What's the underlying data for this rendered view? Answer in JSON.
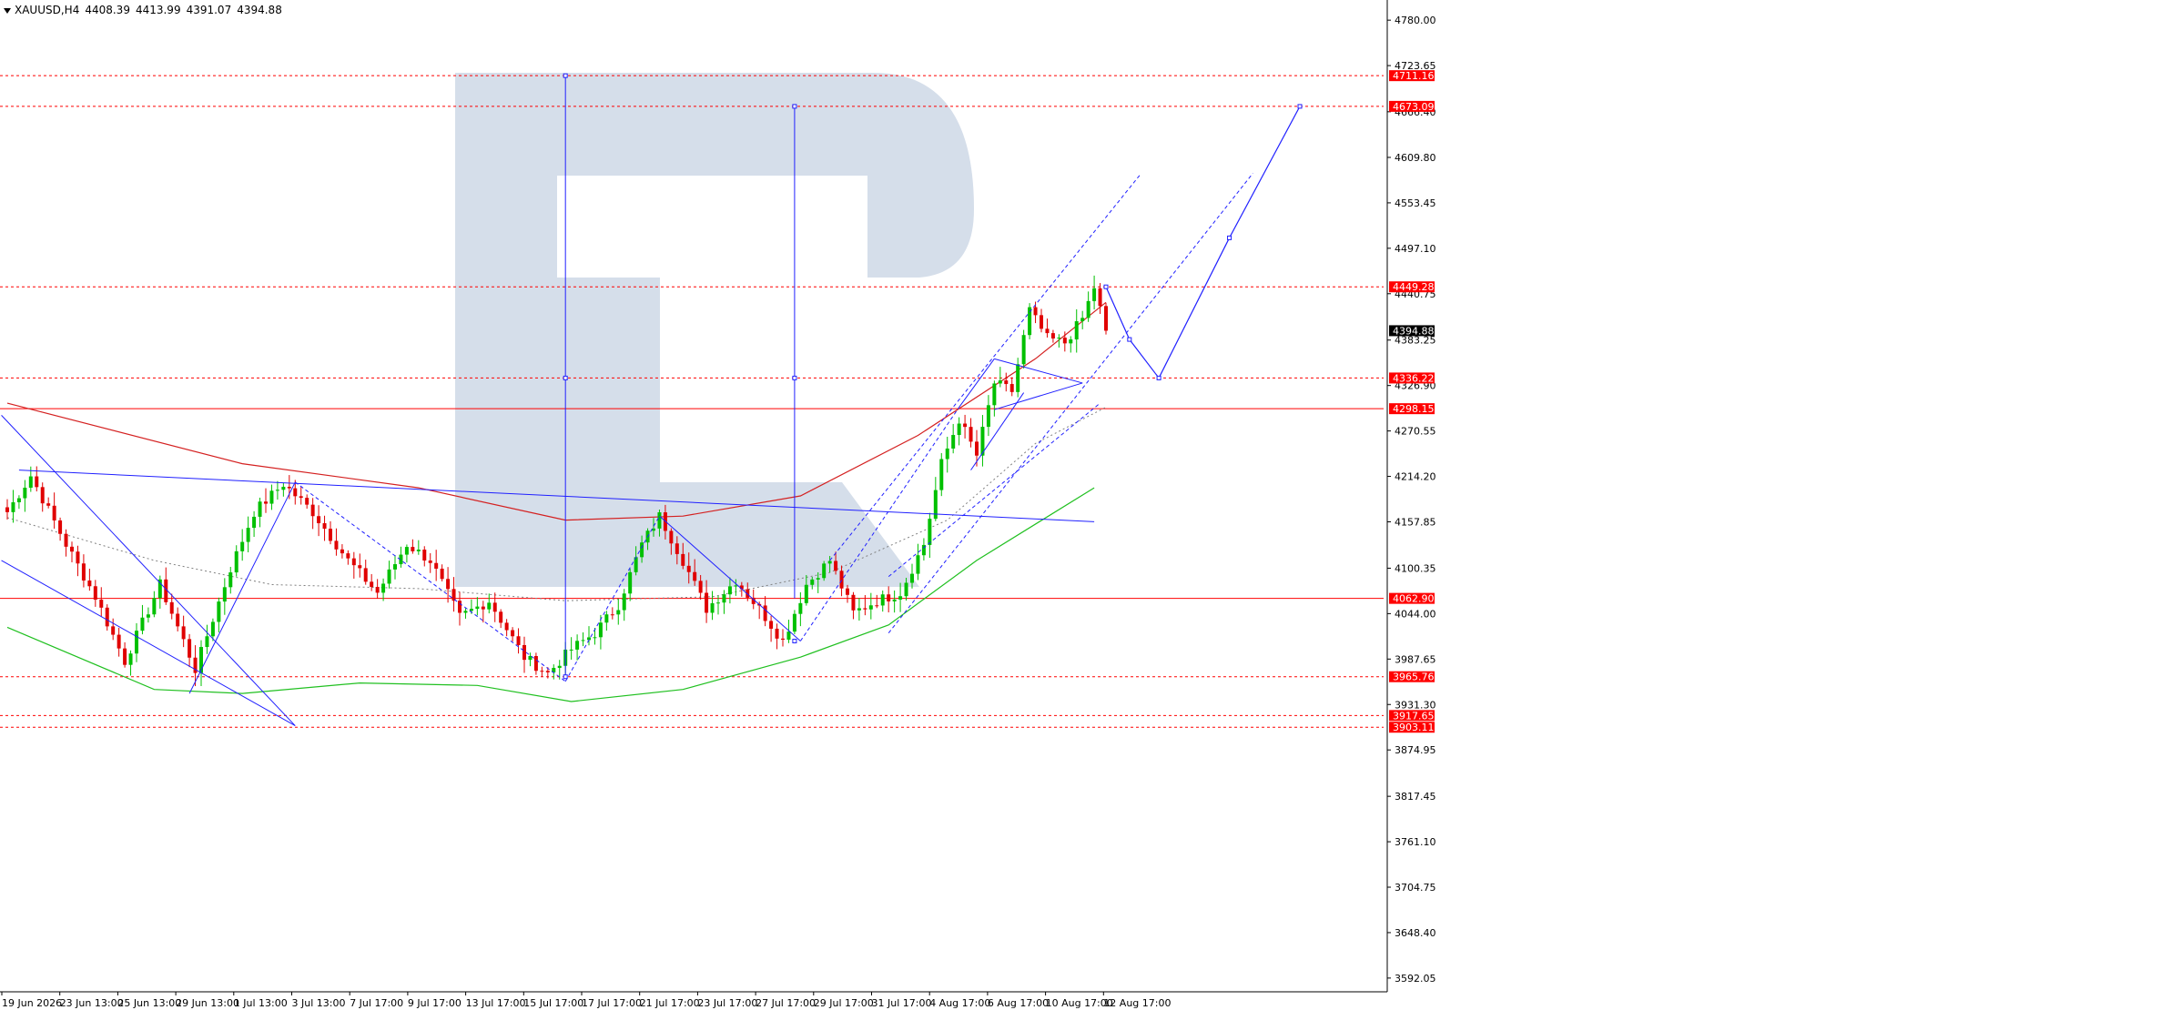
{
  "header": {
    "symbol": "XAUUSD,H4",
    "open": "4408.39",
    "high": "4413.99",
    "low": "4391.07",
    "close": "4394.88"
  },
  "colors": {
    "bull": "#00c000",
    "bear": "#e00000",
    "ma_red": "#d42020",
    "ma_green": "#20c020",
    "ma_dotted": "#808080",
    "trend_blue": "#2020ff",
    "level_red": "#ff0000",
    "watermark": "#d5deea",
    "axis": "#000000"
  },
  "chart_data": {
    "type": "candlestick",
    "symbol": "XAUUSD",
    "timeframe": "H4",
    "ylim": [
      3575,
      4805
    ],
    "y_ticks": [
      "4780.00",
      "4723.65",
      "4666.40",
      "4609.80",
      "4553.45",
      "4497.10",
      "4440.75",
      "4383.25",
      "4326.90",
      "4270.55",
      "4214.20",
      "4157.85",
      "4100.35",
      "4044.00",
      "3987.65",
      "3931.30",
      "3874.95",
      "3817.45",
      "3761.10",
      "3704.75",
      "3648.40",
      "3592.05"
    ],
    "x_ticks": [
      "19 Jun 2026",
      "23 Jun 13:00",
      "25 Jun 13:00",
      "29 Jun 13:00",
      "1 Jul 13:00",
      "3 Jul 13:00",
      "7 Jul 17:00",
      "9 Jul 17:00",
      "13 Jul 17:00",
      "15 Jul 17:00",
      "17 Jul 17:00",
      "21 Jul 17:00",
      "23 Jul 17:00",
      "27 Jul 17:00",
      "29 Jul 17:00",
      "31 Jul 17:00",
      "4 Aug 17:00",
      "6 Aug 17:00",
      "10 Aug 17:00",
      "12 Aug 17:00"
    ],
    "price_levels": [
      {
        "value": 4711.16,
        "label": "4711.16",
        "style": "dotted"
      },
      {
        "value": 4673.09,
        "label": "4673.09",
        "style": "dotted"
      },
      {
        "value": 4449.28,
        "label": "4449.28",
        "style": "dotted"
      },
      {
        "value": 4336.22,
        "label": "4336.22",
        "style": "dotted"
      },
      {
        "value": 4298.15,
        "label": "4298.15",
        "style": "solid"
      },
      {
        "value": 4062.9,
        "label": "4062.90",
        "style": "solid"
      },
      {
        "value": 3965.76,
        "label": "3965.76",
        "style": "dotted"
      },
      {
        "value": 3917.65,
        "label": "3917.65",
        "style": "dotted"
      },
      {
        "value": 3903.11,
        "label": "3903.11",
        "style": "dotted"
      }
    ],
    "current_price": {
      "value": 4394.88,
      "label": "4394.88"
    },
    "price_anchors": [
      {
        "index": 0,
        "price": 4170
      },
      {
        "index": 4,
        "price": 4215
      },
      {
        "index": 10,
        "price": 4130
      },
      {
        "index": 15,
        "price": 4065
      },
      {
        "index": 20,
        "price": 3985
      },
      {
        "index": 26,
        "price": 4080
      },
      {
        "index": 32,
        "price": 3975
      },
      {
        "index": 38,
        "price": 4100
      },
      {
        "index": 42,
        "price": 4170
      },
      {
        "index": 47,
        "price": 4205
      },
      {
        "index": 52,
        "price": 4170
      },
      {
        "index": 58,
        "price": 4110
      },
      {
        "index": 63,
        "price": 4070
      },
      {
        "index": 68,
        "price": 4130
      },
      {
        "index": 72,
        "price": 4110
      },
      {
        "index": 77,
        "price": 4040
      },
      {
        "index": 82,
        "price": 4060
      },
      {
        "index": 88,
        "price": 3990
      },
      {
        "index": 92,
        "price": 3970
      },
      {
        "index": 96,
        "price": 4000
      },
      {
        "index": 100,
        "price": 4020
      },
      {
        "index": 104,
        "price": 4055
      },
      {
        "index": 108,
        "price": 4130
      },
      {
        "index": 111,
        "price": 4165
      },
      {
        "index": 115,
        "price": 4110
      },
      {
        "index": 119,
        "price": 4050
      },
      {
        "index": 124,
        "price": 4085
      },
      {
        "index": 128,
        "price": 4050
      },
      {
        "index": 132,
        "price": 4010
      },
      {
        "index": 136,
        "price": 4080
      },
      {
        "index": 140,
        "price": 4110
      },
      {
        "index": 144,
        "price": 4045
      },
      {
        "index": 148,
        "price": 4060
      },
      {
        "index": 152,
        "price": 4070
      },
      {
        "index": 156,
        "price": 4130
      },
      {
        "index": 159,
        "price": 4230
      },
      {
        "index": 162,
        "price": 4285
      },
      {
        "index": 165,
        "price": 4240
      },
      {
        "index": 168,
        "price": 4330
      },
      {
        "index": 171,
        "price": 4320
      },
      {
        "index": 174,
        "price": 4420
      },
      {
        "index": 177,
        "price": 4385
      },
      {
        "index": 180,
        "price": 4380
      },
      {
        "index": 183,
        "price": 4410
      },
      {
        "index": 185,
        "price": 4449
      },
      {
        "index": 187,
        "price": 4394.88
      }
    ],
    "forecast": [
      {
        "index": 187,
        "price": 4449.28
      },
      {
        "index": 191,
        "price": 4384
      },
      {
        "index": 196,
        "price": 4336.22
      },
      {
        "index": 208,
        "price": 4510
      },
      {
        "index": 220,
        "price": 4673.09
      }
    ]
  }
}
